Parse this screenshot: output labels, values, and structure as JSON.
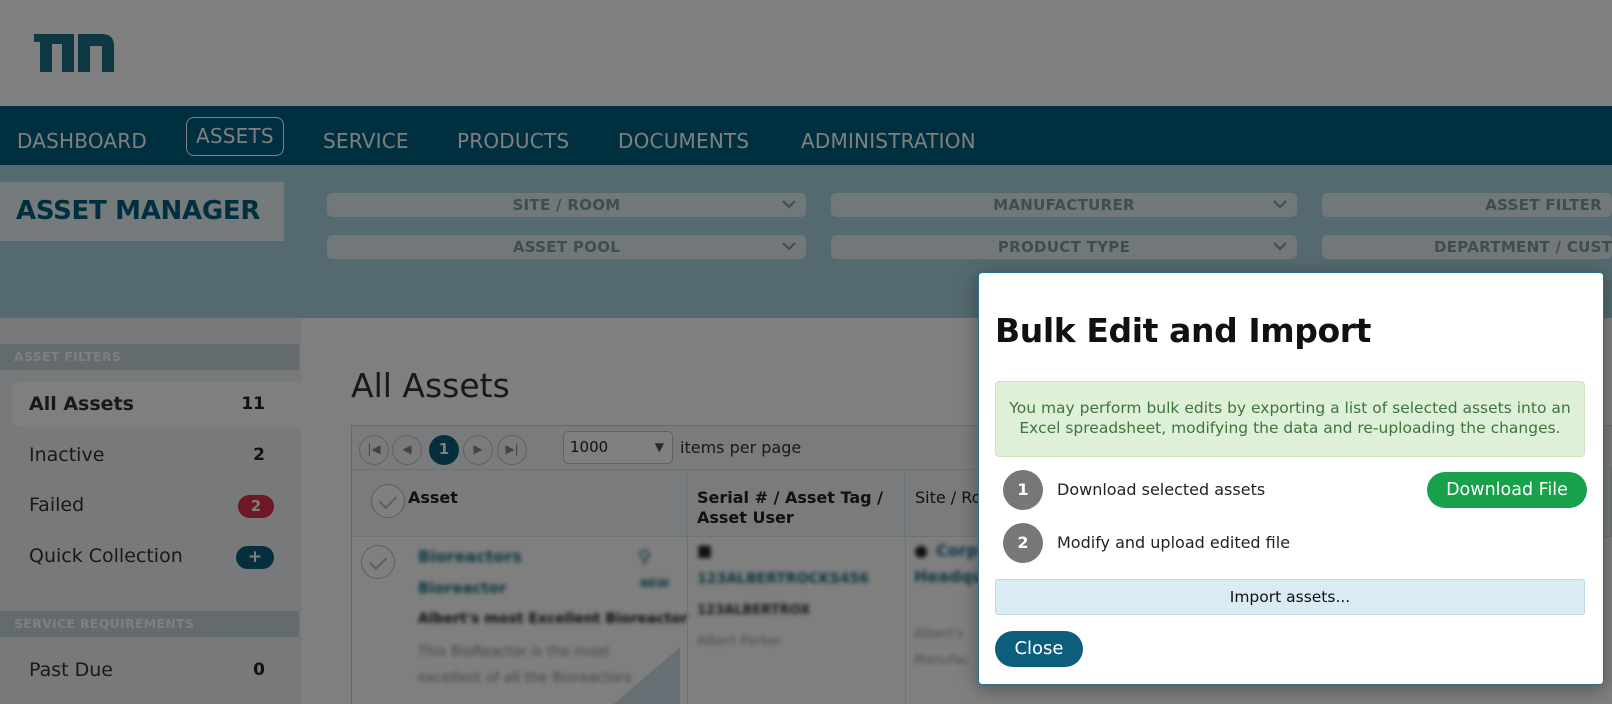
{
  "nav": {
    "items": [
      "DASHBOARD",
      "ASSETS",
      "SERVICE",
      "PRODUCTS",
      "DOCUMENTS",
      "ADMINISTRATION"
    ],
    "active": "ASSETS"
  },
  "header": {
    "logo": "logo-icon"
  },
  "asset_manager": {
    "title": "ASSET MANAGER",
    "filters": [
      "SITE / ROOM",
      "MANUFACTURER",
      "ASSET FILTER",
      "ASSET POOL",
      "PRODUCT TYPE",
      "DEPARTMENT / CUSTO"
    ]
  },
  "sidebar": {
    "asset_filters_heading": "ASSET FILTERS",
    "items": [
      {
        "label": "All Assets",
        "count": "11"
      },
      {
        "label": "Inactive",
        "count": "2"
      },
      {
        "label": "Failed",
        "count": "2"
      },
      {
        "label": "Quick Collection",
        "count": "+"
      }
    ],
    "service_heading": "SERVICE REQUIREMENTS",
    "service_items": [
      {
        "label": "Past Due",
        "count": "0"
      }
    ]
  },
  "main": {
    "title": "All Assets",
    "pager": {
      "current_page": "1",
      "page_size": "1000",
      "label": "items per page"
    },
    "columns": [
      "Asset",
      "Serial # / Asset Tag / Asset User",
      "Site / Ro"
    ],
    "row": {
      "asset_name": "Bioreactors",
      "asset_type": "Bioreactor",
      "asset_desc": "Albert's most Excellent Bioreactor",
      "asset_long": "This BioReactor is the most",
      "asset_long2": "excellent of all the Bioreactors",
      "badge": "NEW",
      "serial": "123ALBERTROCKS456",
      "tag": "123ALBERTROX",
      "user": "Albert Parker",
      "site": "Corp",
      "site2": "Headqu",
      "site3": "Albert's",
      "site4": "Manufac"
    }
  },
  "modal": {
    "title": "Bulk Edit and Import",
    "info": "You may perform bulk edits by exporting a list of selected assets into an Excel spreadsheet, modifying the data and re-uploading the changes.",
    "steps": [
      {
        "num": "1",
        "text": "Download selected assets"
      },
      {
        "num": "2",
        "text": "Modify and upload edited file"
      }
    ],
    "download_label": "Download File",
    "import_label": "Import assets...",
    "close_label": "Close"
  },
  "colors": {
    "nav_bg": "#005f80",
    "brand": "#005f80",
    "success": "#18a14a",
    "danger": "#d9314a"
  }
}
